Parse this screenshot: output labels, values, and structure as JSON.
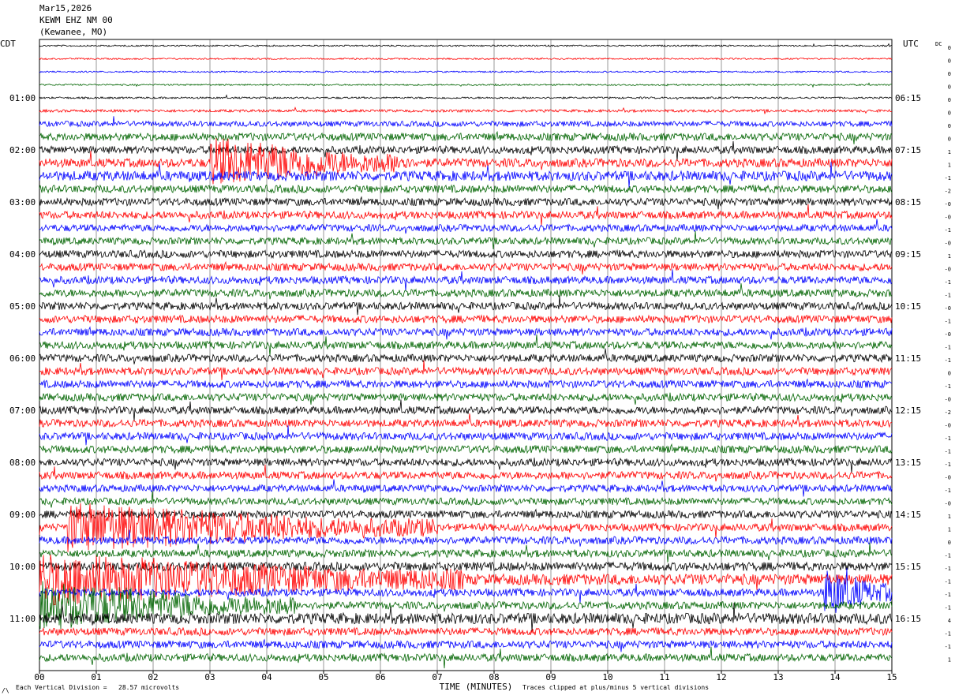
{
  "header": {
    "date": "Mar15,2026",
    "station": "KEWM EHZ NM 00",
    "location": "(Kewanee, MO)"
  },
  "left_axis_title": "CDT",
  "right_axis_title": "UTC",
  "dc_title": "DC",
  "footer": {
    "scale_note": "Each Vertical Division =   28.57 microvolts",
    "clip_note": "Traces clipped at plus/minus 5 vertical divisions",
    "corner_mark": "/\\"
  },
  "colors": {
    "trace_cycle": [
      "#000000",
      "#ff0000",
      "#0000ff",
      "#006400"
    ],
    "grid": "#000000"
  },
  "chart_data": {
    "type": "line",
    "title": "",
    "xlabel": "TIME (MINUTES)",
    "ylabel": "",
    "xlim": [
      0,
      15
    ],
    "x_tick_labels": [
      "00",
      "01",
      "02",
      "03",
      "04",
      "05",
      "06",
      "07",
      "08",
      "09",
      "10",
      "11",
      "12",
      "13",
      "14",
      "15"
    ],
    "left_time_labels": [
      "01:00",
      "02:00",
      "03:00",
      "04:00",
      "05:00",
      "06:00",
      "07:00",
      "08:00",
      "09:00",
      "10:00",
      "11:00"
    ],
    "right_time_labels": [
      "06:15",
      "07:15",
      "08:15",
      "09:15",
      "10:15",
      "11:15",
      "12:15",
      "13:15",
      "14:15",
      "15:15",
      "16:15"
    ],
    "trace_count": 48,
    "traces_per_hour": 4,
    "dc_offsets": [
      "0",
      "0",
      "0",
      "0",
      "0",
      "0",
      "0",
      "0",
      "1",
      "1",
      "-1",
      "-2",
      "-0",
      "-0",
      "-1",
      "-0",
      "1",
      "-0",
      "-1",
      "-1",
      "-0",
      "-1",
      "-0",
      "-1",
      "-1",
      "0",
      "-1",
      "-0",
      "-2",
      "-0",
      "-1",
      "-1",
      "-1",
      "-0",
      "-1",
      "-0",
      "1",
      "1",
      "0",
      "-1",
      "-1",
      "-1",
      "-1",
      "-1",
      "4",
      "-1",
      "-1",
      "1"
    ],
    "trace_activity": [
      0.05,
      0.05,
      0.05,
      0.05,
      0.08,
      0.15,
      0.4,
      0.6,
      0.6,
      0.7,
      0.8,
      0.6,
      0.6,
      0.6,
      0.55,
      0.55,
      0.6,
      0.6,
      0.6,
      0.6,
      0.6,
      0.6,
      0.6,
      0.6,
      0.6,
      0.6,
      0.6,
      0.6,
      0.6,
      0.6,
      0.6,
      0.6,
      0.6,
      0.6,
      0.55,
      0.55,
      0.6,
      0.6,
      0.6,
      0.6,
      0.7,
      0.9,
      0.6,
      0.6,
      0.9,
      0.6,
      0.6,
      0.6
    ],
    "events": [
      {
        "trace": 9,
        "start_min": 3.0,
        "end_min": 6.5,
        "label": ""
      },
      {
        "trace": 37,
        "start_min": 0.5,
        "end_min": 7.0,
        "label": ""
      },
      {
        "trace": 41,
        "start_min": 0.0,
        "end_min": 7.5,
        "label": ""
      },
      {
        "trace": 43,
        "start_min": 0.0,
        "end_min": 4.5,
        "label": ""
      },
      {
        "trace": 42,
        "start_min": 13.8,
        "end_min": 15.0,
        "label": ""
      }
    ]
  }
}
